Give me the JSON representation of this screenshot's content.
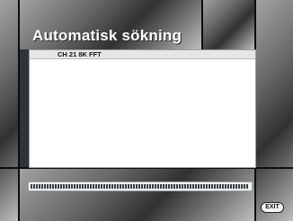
{
  "screen": {
    "title": "Automatisk sökning",
    "channel_info": "CH 21 8K FFT"
  },
  "progress": {
    "value_percent": 99
  },
  "controls": {
    "exit_label": "EXIT"
  }
}
